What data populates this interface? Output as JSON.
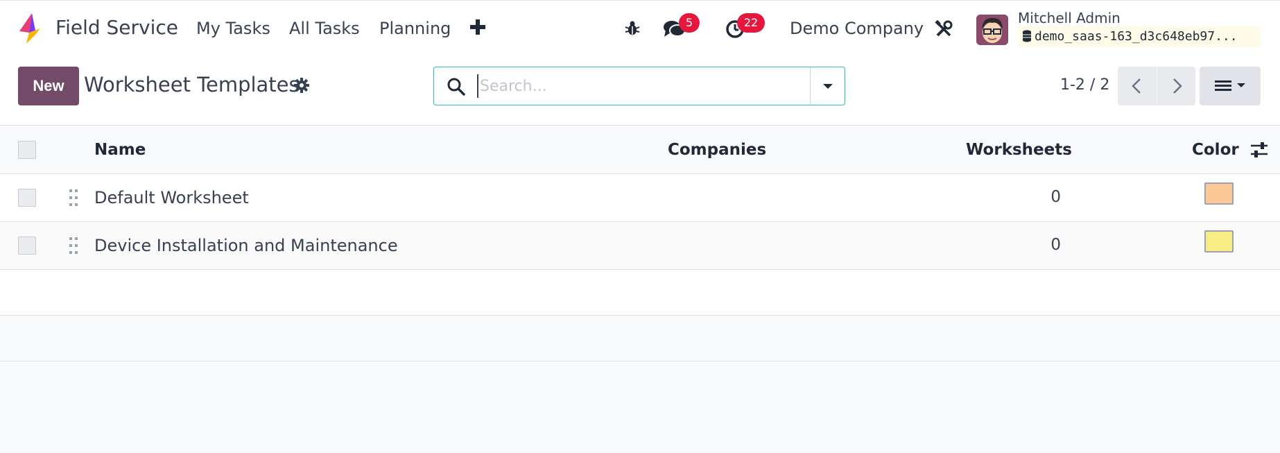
{
  "navbar": {
    "app_name": "Field Service",
    "menu": [
      "My Tasks",
      "All Tasks",
      "Planning"
    ],
    "messages_count": "5",
    "activities_count": "22",
    "company": "Demo Company",
    "user_name": "Mitchell Admin",
    "database": "demo_saas-163_d3c648eb97..."
  },
  "control_panel": {
    "new_label": "New",
    "title": "Worksheet Templates",
    "search_placeholder": "Search...",
    "pager": "1-2 / 2"
  },
  "list": {
    "columns": [
      "Name",
      "Companies",
      "Worksheets",
      "Color"
    ],
    "rows": [
      {
        "name": "Default Worksheet",
        "companies": "",
        "worksheets": "0",
        "color": "#fbc896"
      },
      {
        "name": "Device Installation and Maintenance",
        "companies": "",
        "worksheets": "0",
        "color": "#f8ed84"
      }
    ]
  },
  "colors": {
    "primary": "#714b67",
    "badge": "#e6173d",
    "search_border": "#2dbdb6"
  },
  "icons": [
    "app-logo-icon",
    "plus-icon",
    "bug-icon",
    "chat-icon",
    "clock-icon",
    "tools-icon",
    "database-icon",
    "gear-icon",
    "search-icon",
    "caret-down-icon",
    "chevron-left-icon",
    "chevron-right-icon",
    "list-view-icon",
    "drag-handle-icon",
    "sliders-icon"
  ]
}
